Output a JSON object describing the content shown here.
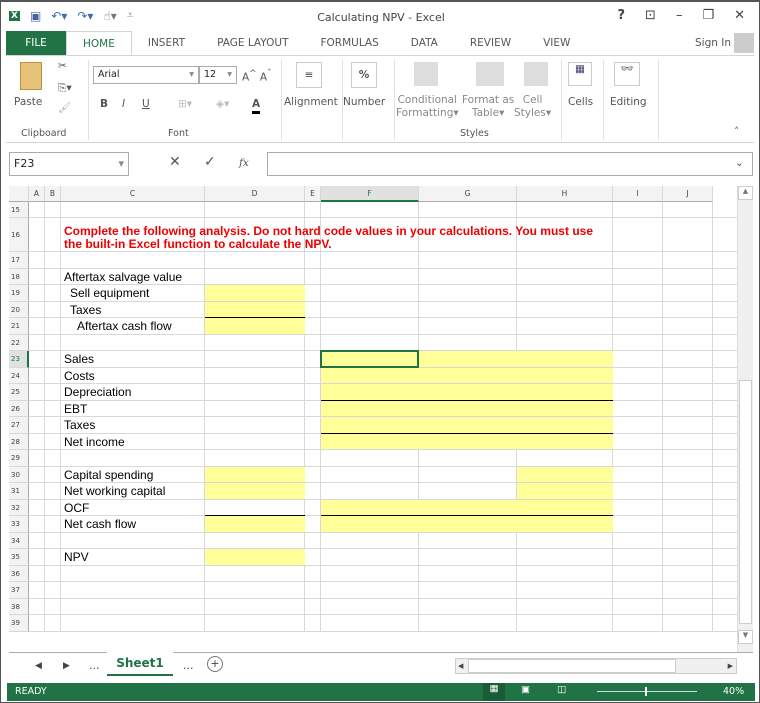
{
  "window": {
    "title": "Calculating NPV - Excel",
    "help": "?",
    "sign_in": "Sign In"
  },
  "tabs": [
    "FILE",
    "HOME",
    "INSERT",
    "PAGE LAYOUT",
    "FORMULAS",
    "DATA",
    "REVIEW",
    "VIEW"
  ],
  "ribbon": {
    "paste": "Paste",
    "font_name": "Arial",
    "font_size": "12",
    "bold": "B",
    "italic": "I",
    "underline": "U",
    "font_color": "A",
    "alignment": "Alignment",
    "number": "Number",
    "percent": "%",
    "conditional": "Conditional",
    "formatting": "Formatting",
    "format_as": "Format as",
    "table": "Table",
    "cell": "Cell",
    "styles_btn": "Styles",
    "cells": "Cells",
    "editing": "Editing",
    "groups": {
      "clipboard": "Clipboard",
      "font": "Font",
      "styles": "Styles"
    }
  },
  "formula_bar": {
    "name_box": "F23",
    "fx": "fx",
    "value": ""
  },
  "columns": [
    "A",
    "B",
    "C",
    "D",
    "E",
    "F",
    "G",
    "H",
    "I",
    "J"
  ],
  "rows": [
    "15",
    "16",
    "17",
    "18",
    "19",
    "20",
    "21",
    "22",
    "23",
    "24",
    "25",
    "26",
    "27",
    "28",
    "29",
    "30",
    "31",
    "32",
    "33",
    "34",
    "35",
    "36",
    "37",
    "38",
    "39"
  ],
  "cells": {
    "instructions": "Complete the following analysis. Do not hard code values in your calculations. You must use the built-in Excel function to calculate the NPV.",
    "r18": "Aftertax salvage value",
    "r19": "Sell equipment",
    "r20": "Taxes",
    "r21": "Aftertax cash flow",
    "r23": "Sales",
    "r24": "Costs",
    "r25": "Depreciation",
    "r26": "EBT",
    "r27": "Taxes",
    "r28": "Net income",
    "r30": "Capital spending",
    "r31": "Net working capital",
    "r32": "OCF",
    "r33": "Net cash flow",
    "r35": "NPV"
  },
  "sheets": {
    "active": "Sheet1",
    "more": "..."
  },
  "status": {
    "ready": "READY",
    "zoom": "40%"
  },
  "colors": {
    "excel_green": "#217346",
    "input_fill": "#ffff99",
    "instruction_red": "#ee0000"
  }
}
